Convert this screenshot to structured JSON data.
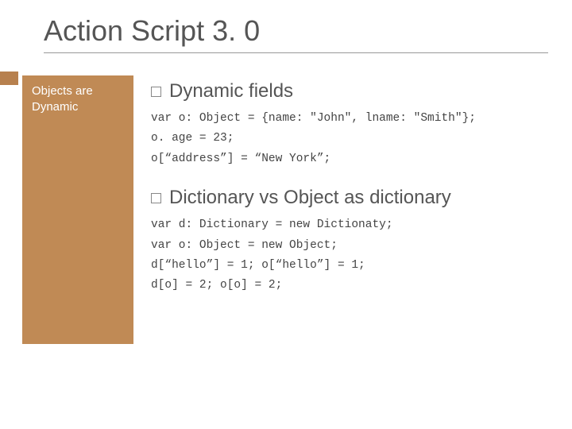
{
  "title": "Action Script 3. 0",
  "sidebar": {
    "line1": "Objects are",
    "line2": "Dynamic"
  },
  "sections": [
    {
      "heading": "Dynamic fields",
      "code": "var o: Object = {name: \"John\", lname: \"Smith\"};\no. age = 23;\no[“address”] = “New York”;"
    },
    {
      "heading": "Dictionary vs Object as dictionary",
      "code": "var d: Dictionary = new Dictionaty;\nvar o: Object = new Object;\nd[“hello”] = 1; o[“hello”] = 1;\nd[o] = 2; o[o] = 2;"
    }
  ]
}
